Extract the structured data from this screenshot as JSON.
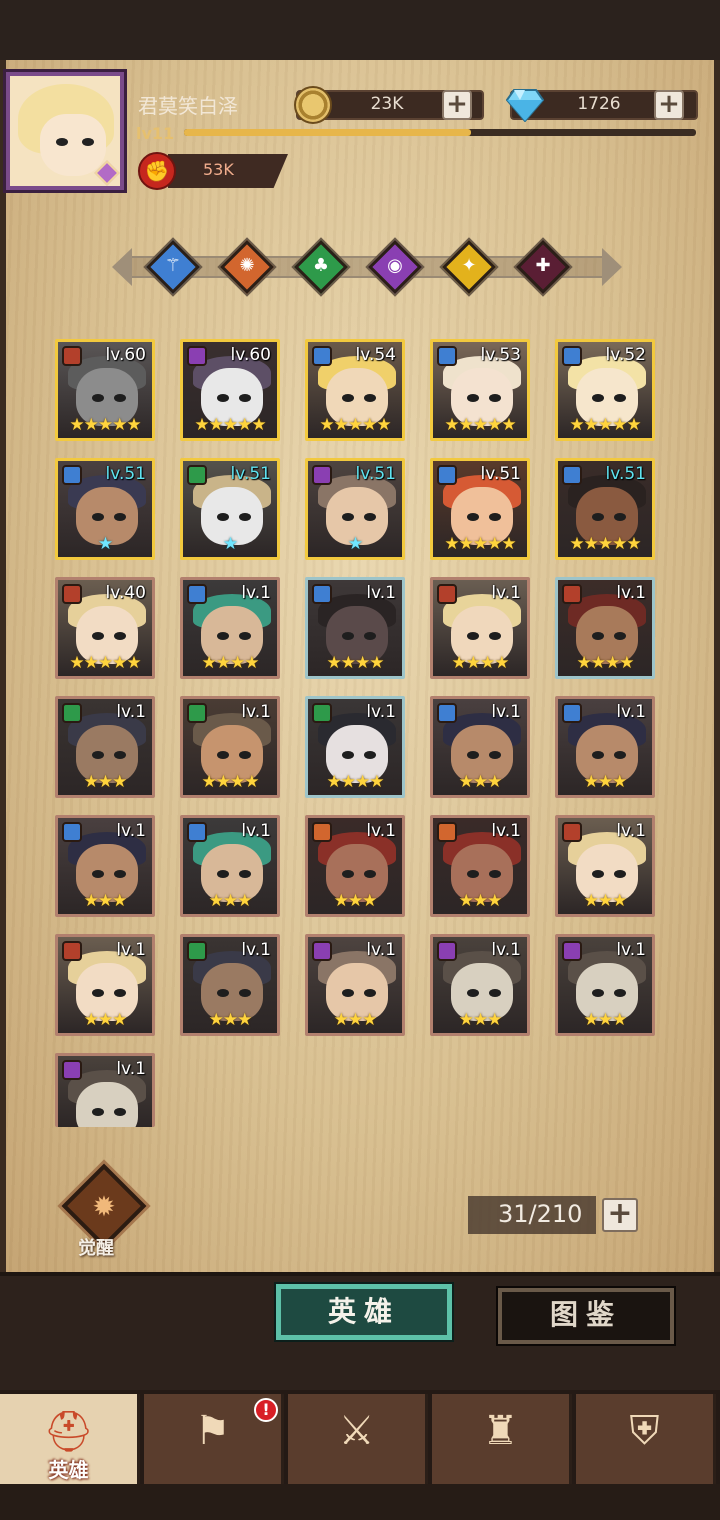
{
  "player": {
    "name": "君莫笑白泽",
    "level": "lv11",
    "xp_fraction": 0.56,
    "power": "53K"
  },
  "resources": {
    "coins": "23K",
    "gems": "1726",
    "plus": "+"
  },
  "factions": [
    {
      "name": "faction-blue",
      "color": "#3f7fd2",
      "glyph": "⚚"
    },
    {
      "name": "faction-orange",
      "color": "#d2662e",
      "glyph": "✺"
    },
    {
      "name": "faction-green",
      "color": "#2e9a4a",
      "glyph": "♣"
    },
    {
      "name": "faction-purple",
      "color": "#8a3fb2",
      "glyph": "◉"
    },
    {
      "name": "faction-gold",
      "color": "#e3b21c",
      "glyph": "✦"
    },
    {
      "name": "faction-dark",
      "color": "#5a1e34",
      "glyph": "✚"
    }
  ],
  "heroes": [
    {
      "level": "lv.60",
      "stars": "★★★★★",
      "star_color": "gold",
      "frame": "gold",
      "badge": "#b3402b",
      "skin": "#8c8c8c",
      "hair": "#5c5c5c",
      "bg": "#5a5656",
      "teal": false
    },
    {
      "level": "lv.60",
      "stars": "★★★★★",
      "star_color": "gold",
      "frame": "gold",
      "badge": "#8a3fb2",
      "skin": "#e8e8e8",
      "hair": "#5d4f66",
      "bg": "#3a2f2f",
      "teal": false
    },
    {
      "level": "lv.54",
      "stars": "★★★★★",
      "star_color": "gold",
      "frame": "gold",
      "badge": "#3f7fd2",
      "skin": "#f0d8b8",
      "hair": "#f0d06a",
      "bg": "#6b5a4a",
      "teal": false
    },
    {
      "level": "lv.53",
      "stars": "★★★★★",
      "star_color": "gold",
      "frame": "gold",
      "badge": "#3f7fd2",
      "skin": "#f4e2d0",
      "hair": "#efe2cc",
      "bg": "#7a6858",
      "teal": false
    },
    {
      "level": "lv.52",
      "stars": "★★★★★",
      "star_color": "gold",
      "frame": "gold",
      "badge": "#3f7fd2",
      "skin": "#f6e6cc",
      "hair": "#f3e2a6",
      "bg": "#7a6a58",
      "teal": false
    },
    {
      "level": "lv.51",
      "stars": "★",
      "star_color": "blue",
      "frame": "gold",
      "badge": "#3f7fd2",
      "skin": "#b78a6a",
      "hair": "#3a3a52",
      "bg": "#4a4040",
      "teal": true
    },
    {
      "level": "lv.51",
      "stars": "★",
      "star_color": "blue",
      "frame": "gold",
      "badge": "#2e9a4a",
      "skin": "#e8e8e8",
      "hair": "#c9b489",
      "bg": "#54524c",
      "teal": true
    },
    {
      "level": "lv.51",
      "stars": "★",
      "star_color": "blue",
      "frame": "gold",
      "badge": "#8a3fb2",
      "skin": "#e6c7a8",
      "hair": "#8a7566",
      "bg": "#4e4440",
      "teal": true
    },
    {
      "level": "lv.51",
      "stars": "★★★★★",
      "star_color": "gold",
      "frame": "gold",
      "badge": "#3f7fd2",
      "skin": "#f0c09a",
      "hair": "#d65a34",
      "bg": "#5a3a2a",
      "teal": false
    },
    {
      "level": "lv.51",
      "stars": "★★★★★",
      "star_color": "gold",
      "frame": "gold",
      "badge": "#3f7fd2",
      "skin": "#8a5a40",
      "hair": "#2a2220",
      "bg": "#3a2c28",
      "teal": true
    },
    {
      "level": "lv.40",
      "stars": "★★★★★",
      "star_color": "gold",
      "frame": "brown",
      "badge": "#b3402b",
      "skin": "#f2dcc4",
      "hair": "#e6d09a",
      "bg": "#6b5e50",
      "teal": false
    },
    {
      "level": "lv.1",
      "stars": "★★★★",
      "star_color": "gold",
      "frame": "brown",
      "badge": "#3f7fd2",
      "skin": "#d8b898",
      "hair": "#3b9a82",
      "bg": "#3c3a3a",
      "teal": false
    },
    {
      "level": "lv.1",
      "stars": "★★★★",
      "star_color": "gold",
      "frame": "cyan",
      "badge": "#3f7fd2",
      "skin": "#5a4a4a",
      "hair": "#2a2424",
      "bg": "#3e3838",
      "teal": false
    },
    {
      "level": "lv.1",
      "stars": "★★★★",
      "star_color": "gold",
      "frame": "brown",
      "badge": "#b3402b",
      "skin": "#f0d8bc",
      "hair": "#e8d49a",
      "bg": "#6a5e52",
      "teal": false
    },
    {
      "level": "lv.1",
      "stars": "★★★★",
      "star_color": "gold",
      "frame": "cyan",
      "badge": "#b3402b",
      "skin": "#a87a5a",
      "hair": "#6e2a24",
      "bg": "#3c2c28",
      "teal": false
    },
    {
      "level": "lv.1",
      "stars": "★★★",
      "star_color": "gold",
      "frame": "brown",
      "badge": "#2e9a4a",
      "skin": "#9a7a62",
      "hair": "#3a3a48",
      "bg": "#3a3432",
      "teal": false
    },
    {
      "level": "lv.1",
      "stars": "★★★★",
      "star_color": "gold",
      "frame": "brown",
      "badge": "#2e9a4a",
      "skin": "#c6946e",
      "hair": "#6a5a4a",
      "bg": "#4a3c34",
      "teal": false
    },
    {
      "level": "lv.1",
      "stars": "★★★★",
      "star_color": "gold",
      "frame": "cyan",
      "badge": "#2e9a4a",
      "skin": "#e6e0e0",
      "hair": "#2a2a30",
      "bg": "#3a3636",
      "teal": false
    },
    {
      "level": "lv.1",
      "stars": "★★★",
      "star_color": "gold",
      "frame": "brown",
      "badge": "#3f7fd2",
      "skin": "#b78a6a",
      "hair": "#2e2e44",
      "bg": "#4a4040",
      "teal": false
    },
    {
      "level": "lv.1",
      "stars": "★★★",
      "star_color": "gold",
      "frame": "brown",
      "badge": "#3f7fd2",
      "skin": "#b78a6a",
      "hair": "#2e2e44",
      "bg": "#4a4040",
      "teal": false
    },
    {
      "level": "lv.1",
      "stars": "★★★",
      "star_color": "gold",
      "frame": "brown",
      "badge": "#3f7fd2",
      "skin": "#b78a6a",
      "hair": "#2e2e44",
      "bg": "#4a4040",
      "teal": false
    },
    {
      "level": "lv.1",
      "stars": "★★★",
      "star_color": "gold",
      "frame": "brown",
      "badge": "#3f7fd2",
      "skin": "#d8b898",
      "hair": "#3b9a82",
      "bg": "#3c3a3a",
      "teal": false
    },
    {
      "level": "lv.1",
      "stars": "★★★",
      "star_color": "gold",
      "frame": "brown",
      "badge": "#d2662e",
      "skin": "#a8705a",
      "hair": "#8a3028",
      "bg": "#3a2a28",
      "teal": false
    },
    {
      "level": "lv.1",
      "stars": "★★★",
      "star_color": "gold",
      "frame": "brown",
      "badge": "#d2662e",
      "skin": "#a8705a",
      "hair": "#8a3028",
      "bg": "#3a2a28",
      "teal": false
    },
    {
      "level": "lv.1",
      "stars": "★★★",
      "star_color": "gold",
      "frame": "brown",
      "badge": "#b3402b",
      "skin": "#f2dcc4",
      "hair": "#e6d09a",
      "bg": "#6b5e50",
      "teal": false
    },
    {
      "level": "lv.1",
      "stars": "★★★",
      "star_color": "gold",
      "frame": "brown",
      "badge": "#b3402b",
      "skin": "#f2dcc4",
      "hair": "#e6d09a",
      "bg": "#6b5e50",
      "teal": false
    },
    {
      "level": "lv.1",
      "stars": "★★★",
      "star_color": "gold",
      "frame": "brown",
      "badge": "#2e9a4a",
      "skin": "#9a7a62",
      "hair": "#3a3a48",
      "bg": "#3a3432",
      "teal": false
    },
    {
      "level": "lv.1",
      "stars": "★★★",
      "star_color": "gold",
      "frame": "brown",
      "badge": "#8a3fb2",
      "skin": "#e6c7a8",
      "hair": "#8a7566",
      "bg": "#4e4440",
      "teal": false
    },
    {
      "level": "lv.1",
      "stars": "★★★",
      "star_color": "gold",
      "frame": "brown",
      "badge": "#8a3fb2",
      "skin": "#d8d0c0",
      "hair": "#5a5048",
      "bg": "#4a423c",
      "teal": false
    },
    {
      "level": "lv.1",
      "stars": "★★★",
      "star_color": "gold",
      "frame": "brown",
      "badge": "#8a3fb2",
      "skin": "#d8d0c0",
      "hair": "#5a5048",
      "bg": "#4a423c",
      "teal": false
    },
    {
      "level": "lv.1",
      "stars": "",
      "star_color": "gold",
      "frame": "brown",
      "badge": "#8a3fb2",
      "skin": "#d8d0c0",
      "hair": "#5a5048",
      "bg": "#4a423c",
      "teal": false
    }
  ],
  "awaken_label": "觉醒",
  "hero_count": "31/210",
  "tabs": {
    "heroes": "英雄",
    "codex": "图鉴"
  },
  "nav": [
    {
      "name": "nav-heroes",
      "label": "英雄",
      "glyph": "⛑",
      "active": true
    },
    {
      "name": "nav-adventure",
      "label": "",
      "glyph": "⚑",
      "active": false,
      "alert": "!"
    },
    {
      "name": "nav-battle",
      "label": "",
      "glyph": "⚔",
      "active": false
    },
    {
      "name": "nav-castle",
      "label": "",
      "glyph": "♜",
      "active": false
    },
    {
      "name": "nav-guild",
      "label": "",
      "glyph": "⛨",
      "active": false
    }
  ]
}
